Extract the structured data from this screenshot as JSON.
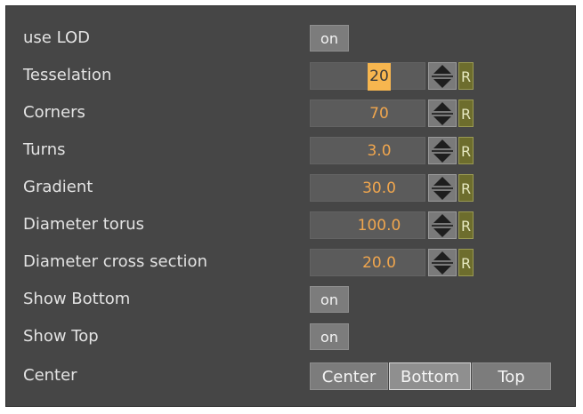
{
  "rows": {
    "use_lod": {
      "label": "use LOD",
      "toggle": "on"
    },
    "tesselation": {
      "label": "Tesselation",
      "value": "20",
      "reset": "R"
    },
    "corners": {
      "label": "Corners",
      "value": "70",
      "reset": "R"
    },
    "turns": {
      "label": "Turns",
      "value": "3.0",
      "reset": "R"
    },
    "gradient": {
      "label": "Gradient",
      "value": "30.0",
      "reset": "R"
    },
    "diameter_torus": {
      "label": "Diameter torus",
      "value": "100.0",
      "reset": "R"
    },
    "diameter_cross": {
      "label": "Diameter cross section",
      "value": "20.0",
      "reset": "R"
    },
    "show_bottom": {
      "label": "Show Bottom",
      "toggle": "on"
    },
    "show_top": {
      "label": "Show Top",
      "toggle": "on"
    },
    "center": {
      "label": "Center",
      "options": [
        "Center",
        "Bottom",
        "Top"
      ],
      "selected": "Bottom"
    }
  },
  "icons": {
    "spinner": "up-down-arrows-icon"
  },
  "colors": {
    "panel_bg": "#464646",
    "value_text": "#f0a64e",
    "selected_value_bg": "#f7b64f",
    "reset_bg": "#6d6d2d"
  }
}
